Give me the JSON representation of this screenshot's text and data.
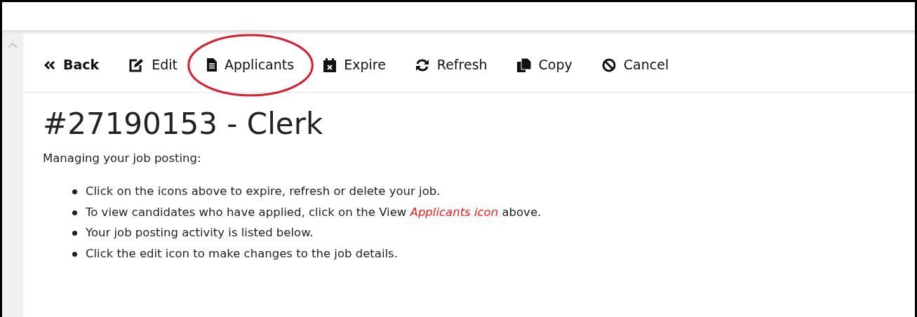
{
  "toolbar": [
    {
      "kind": "back",
      "label": "Back",
      "bold": true,
      "circled": false
    },
    {
      "kind": "edit",
      "label": "Edit",
      "bold": false,
      "circled": false
    },
    {
      "kind": "file",
      "label": "Applicants",
      "bold": false,
      "circled": true
    },
    {
      "kind": "calendar",
      "label": "Expire",
      "bold": false,
      "circled": false
    },
    {
      "kind": "refresh",
      "label": "Refresh",
      "bold": false,
      "circled": false
    },
    {
      "kind": "copy",
      "label": "Copy",
      "bold": false,
      "circled": false
    },
    {
      "kind": "cancel",
      "label": "Cancel",
      "bold": false,
      "circled": false
    }
  ],
  "heading": "#27190153 - Clerk",
  "intro": "Managing your job posting:",
  "bullets": [
    [
      {
        "text": "Click on the icons above to expire, refresh or delete your job.",
        "highlight": false
      }
    ],
    [
      {
        "text": "To view candidates who have applied, click on the View ",
        "highlight": false
      },
      {
        "text": "Applicants icon",
        "highlight": true
      },
      {
        "text": " above.",
        "highlight": false
      }
    ],
    [
      {
        "text": "Your job posting activity is listed below.",
        "highlight": false
      }
    ],
    [
      {
        "text": "Click the edit icon to make changes to the job details.",
        "highlight": false
      }
    ]
  ]
}
